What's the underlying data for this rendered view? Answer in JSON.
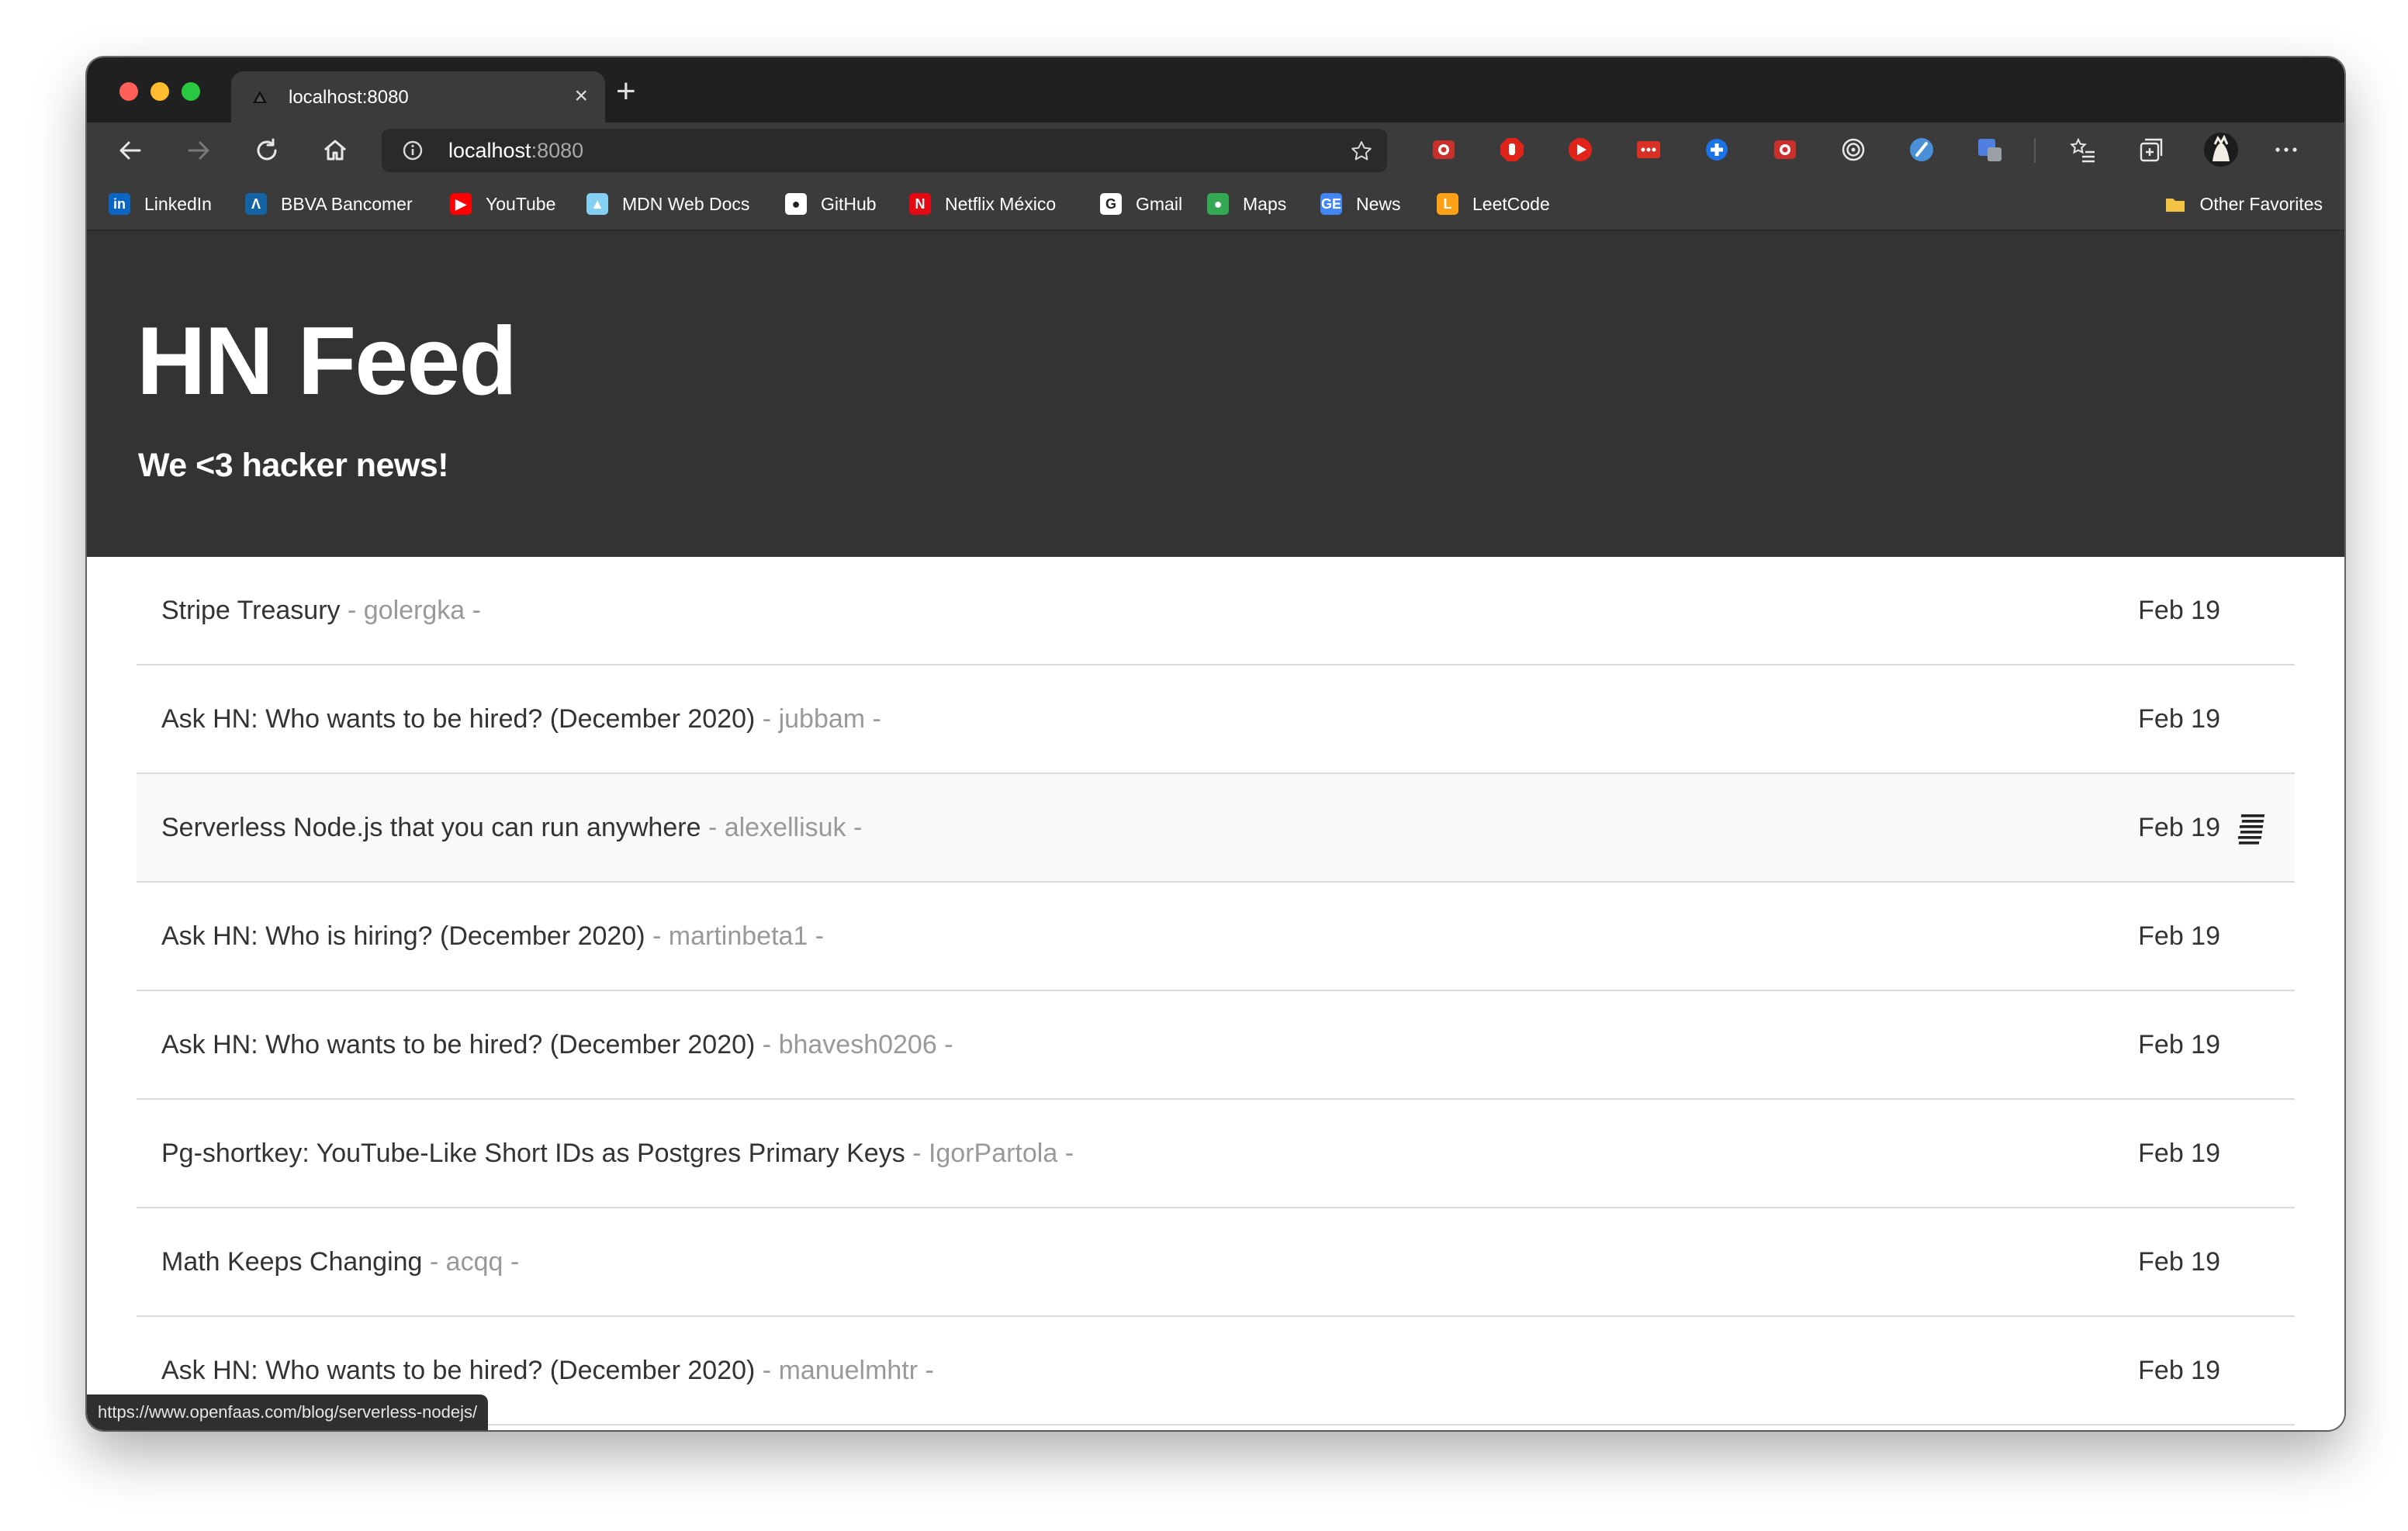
{
  "browser": {
    "tab": {
      "title": "localhost:8080",
      "close_glyph": "×"
    },
    "new_tab_glyph": "+",
    "address": {
      "host": "localhost",
      "port": ":8080"
    },
    "bookmarks": [
      {
        "label": "LinkedIn",
        "icon": "linkedin-icon",
        "color": "#0a66c2",
        "glyph": "in"
      },
      {
        "label": "BBVA Bancomer",
        "icon": "bbva-icon",
        "color": "#1464a5",
        "glyph": "Λ"
      },
      {
        "label": "YouTube",
        "icon": "youtube-icon",
        "color": "#ff0000",
        "glyph": "▶"
      },
      {
        "label": "MDN Web Docs",
        "icon": "mdn-icon",
        "color": "#83d0f2",
        "glyph": "▲"
      },
      {
        "label": "GitHub",
        "icon": "github-icon",
        "color": "#ffffff",
        "glyph": "●"
      },
      {
        "label": "Netflix México",
        "icon": "netflix-icon",
        "color": "#e50914",
        "glyph": "N"
      },
      {
        "label": "Gmail",
        "icon": "google-icon",
        "color": "#ffffff",
        "glyph": "G"
      },
      {
        "label": "Maps",
        "icon": "maps-icon",
        "color": "#34a853",
        "glyph": "●"
      },
      {
        "label": "News",
        "icon": "google-news-icon",
        "color": "#4285f4",
        "glyph": "GE"
      },
      {
        "label": "LeetCode",
        "icon": "leetcode-icon",
        "color": "#ffa116",
        "glyph": "L"
      }
    ],
    "other_favorites": "Other Favorites",
    "status_url": "https://www.openfaas.com/blog/serverless-nodejs/"
  },
  "page": {
    "title": "HN Feed",
    "subtitle": "We <3 hacker news!",
    "stories": [
      {
        "title": "Stripe Treasury",
        "author": "- golergka -",
        "date": "Feb 19"
      },
      {
        "title": "Ask HN: Who wants to be hired? (December 2020)",
        "author": "- jubbam -",
        "date": "Feb 19"
      },
      {
        "title": "Serverless Node.js that you can run anywhere",
        "author": "- alexellisuk -",
        "date": "Feb 19"
      },
      {
        "title": "Ask HN: Who is hiring? (December 2020)",
        "author": "- martinbeta1 -",
        "date": "Feb 19"
      },
      {
        "title": "Ask HN: Who wants to be hired? (December 2020)",
        "author": "- bhavesh0206 -",
        "date": "Feb 19"
      },
      {
        "title": "Pg-shortkey: YouTube-Like Short IDs as Postgres Primary Keys",
        "author": "- IgorPartola -",
        "date": "Feb 19"
      },
      {
        "title": "Math Keeps Changing",
        "author": "- acqq -",
        "date": "Feb 19"
      },
      {
        "title": "Ask HN: Who wants to be hired? (December 2020)",
        "author": "- manuelmhtr -",
        "date": "Feb 19"
      }
    ],
    "hovered_index": 2
  },
  "colors": {
    "hero_bg": "#333333",
    "chrome_dark": "#202020",
    "chrome_toolbar": "#3b3b3b",
    "author_text": "#999999"
  }
}
